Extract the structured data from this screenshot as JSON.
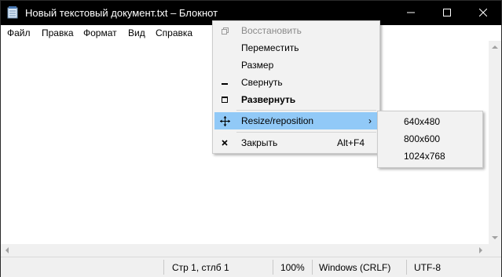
{
  "window": {
    "title": "Новый текстовый документ.txt – Блокнот",
    "icon": "notepad-icon",
    "controls": {
      "minimize": "minimize-icon",
      "maximize": "maximize-icon",
      "close": "close-icon"
    }
  },
  "menubar": {
    "items": [
      {
        "label": "Файл"
      },
      {
        "label": "Правка"
      },
      {
        "label": "Формат"
      },
      {
        "label": "Вид"
      },
      {
        "label": "Справка"
      }
    ]
  },
  "system_menu": {
    "items": [
      {
        "label": "Восстановить",
        "icon": "restore-icon",
        "disabled": true
      },
      {
        "label": "Переместить"
      },
      {
        "label": "Размер"
      },
      {
        "label": "Свернуть",
        "icon": "minimize-icon"
      },
      {
        "label": "Развернуть",
        "icon": "maximize-icon",
        "bold": true
      },
      {
        "label": "Resize/reposition",
        "icon": "move-icon",
        "highlighted": true,
        "has_submenu": true
      },
      {
        "label": "Закрыть",
        "icon": "close-icon",
        "shortcut": "Alt+F4"
      }
    ],
    "submenu_arrow": "›"
  },
  "submenu": {
    "items": [
      {
        "label": "640x480"
      },
      {
        "label": "800x600"
      },
      {
        "label": "1024x768"
      }
    ]
  },
  "statusbar": {
    "position": "Стр 1, стлб 1",
    "zoom": "100%",
    "line_ending": "Windows (CRLF)",
    "encoding": "UTF-8"
  },
  "colors": {
    "titlebar": "#000000",
    "highlight": "#91c9f7",
    "menu_bg": "#f2f2f2",
    "statusbar_bg": "#f0f0f0"
  }
}
